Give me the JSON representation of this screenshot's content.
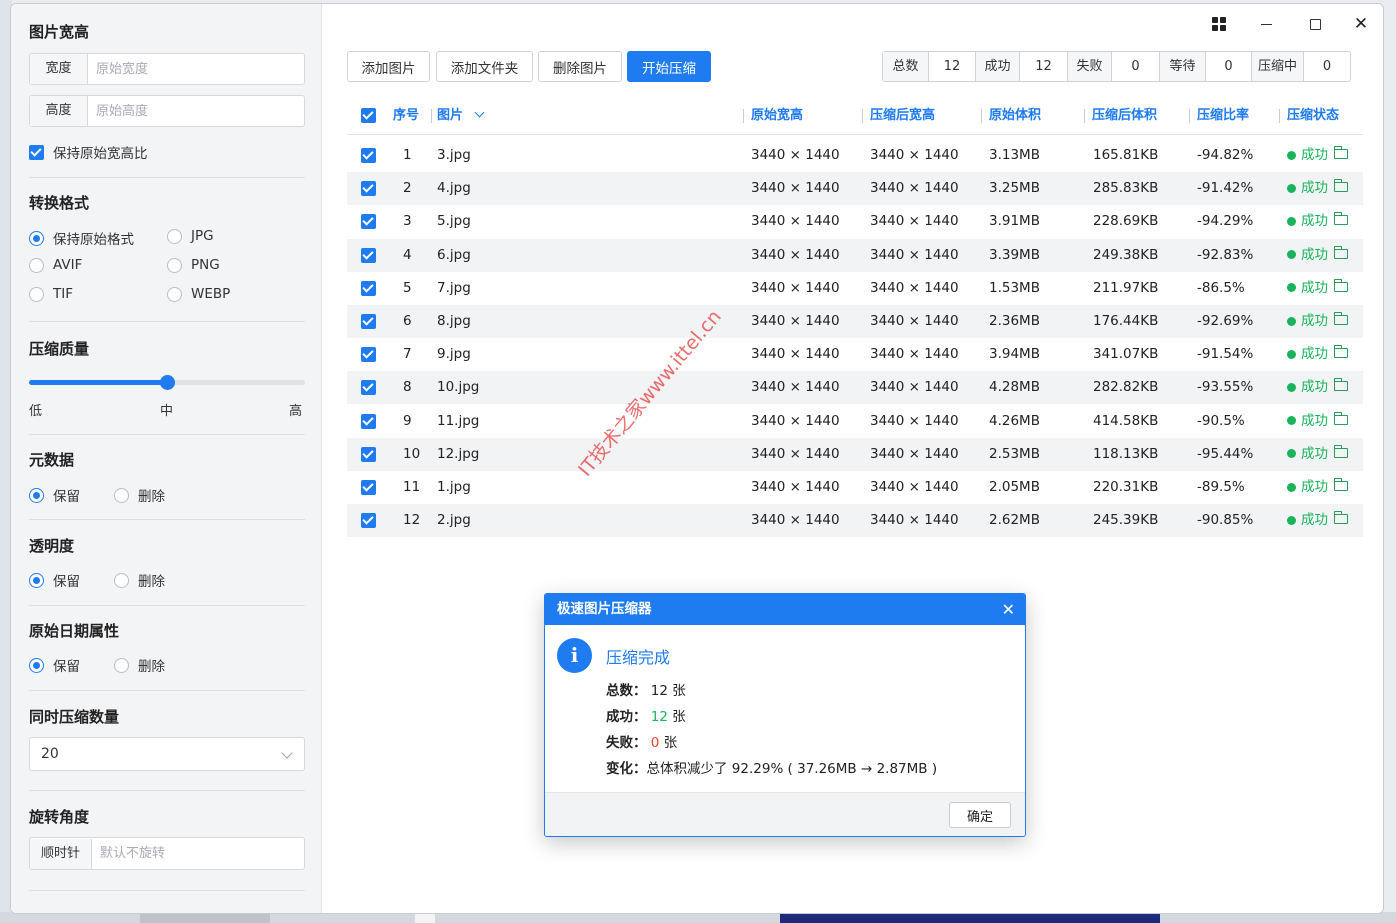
{
  "left_panel": {
    "size_section": {
      "title": "图片宽高",
      "width_label": "宽度",
      "width_placeholder": "原始宽度",
      "height_label": "高度",
      "height_placeholder": "原始高度",
      "keep_ratio_label": "保持原始宽高比",
      "keep_ratio_checked": true
    },
    "format_section": {
      "title": "转换格式",
      "options": [
        "保持原始格式",
        "JPG",
        "AVIF",
        "PNG",
        "TIF",
        "WEBP"
      ],
      "selected": "保持原始格式"
    },
    "quality_section": {
      "title": "压缩质量",
      "low": "低",
      "mid": "中",
      "high": "高",
      "value_fraction": 0.5
    },
    "metadata_section": {
      "title": "元数据",
      "keep": "保留",
      "delete": "删除",
      "selected": "保留"
    },
    "transparency_section": {
      "title": "透明度",
      "keep": "保留",
      "delete": "删除",
      "selected": "保留"
    },
    "date_section": {
      "title": "原始日期属性",
      "keep": "保留",
      "delete": "删除",
      "selected": "保留"
    },
    "concurrency_section": {
      "title": "同时压缩数量",
      "value": "20"
    },
    "rotation_section": {
      "title": "旋转角度",
      "label": "顺时针",
      "placeholder": "默认不旋转"
    }
  },
  "toolbar": {
    "add_image": "添加图片",
    "add_folder": "添加文件夹",
    "delete_image": "删除图片",
    "start": "开始压缩"
  },
  "stats": {
    "total_label": "总数",
    "total": "12",
    "success_label": "成功",
    "success": "12",
    "fail_label": "失败",
    "fail": "0",
    "waiting_label": "等待",
    "waiting": "0",
    "compressing_label": "压缩中",
    "compressing": "0"
  },
  "table": {
    "columns": [
      "序号",
      "图片",
      "原始宽高",
      "压缩后宽高",
      "原始体积",
      "压缩后体积",
      "压缩比率",
      "压缩状态"
    ],
    "rows": [
      {
        "idx": "1",
        "name": "3.jpg",
        "orig": "3440 × 1440",
        "new": "3440 × 1440",
        "orig_size": "3.13MB",
        "new_size": "165.81KB",
        "ratio": "-94.82%",
        "status": "成功"
      },
      {
        "idx": "2",
        "name": "4.jpg",
        "orig": "3440 × 1440",
        "new": "3440 × 1440",
        "orig_size": "3.25MB",
        "new_size": "285.83KB",
        "ratio": "-91.42%",
        "status": "成功"
      },
      {
        "idx": "3",
        "name": "5.jpg",
        "orig": "3440 × 1440",
        "new": "3440 × 1440",
        "orig_size": "3.91MB",
        "new_size": "228.69KB",
        "ratio": "-94.29%",
        "status": "成功"
      },
      {
        "idx": "4",
        "name": "6.jpg",
        "orig": "3440 × 1440",
        "new": "3440 × 1440",
        "orig_size": "3.39MB",
        "new_size": "249.38KB",
        "ratio": "-92.83%",
        "status": "成功"
      },
      {
        "idx": "5",
        "name": "7.jpg",
        "orig": "3440 × 1440",
        "new": "3440 × 1440",
        "orig_size": "1.53MB",
        "new_size": "211.97KB",
        "ratio": "-86.5%",
        "status": "成功"
      },
      {
        "idx": "6",
        "name": "8.jpg",
        "orig": "3440 × 1440",
        "new": "3440 × 1440",
        "orig_size": "2.36MB",
        "new_size": "176.44KB",
        "ratio": "-92.69%",
        "status": "成功"
      },
      {
        "idx": "7",
        "name": "9.jpg",
        "orig": "3440 × 1440",
        "new": "3440 × 1440",
        "orig_size": "3.94MB",
        "new_size": "341.07KB",
        "ratio": "-91.54%",
        "status": "成功"
      },
      {
        "idx": "8",
        "name": "10.jpg",
        "orig": "3440 × 1440",
        "new": "3440 × 1440",
        "orig_size": "4.28MB",
        "new_size": "282.82KB",
        "ratio": "-93.55%",
        "status": "成功"
      },
      {
        "idx": "9",
        "name": "11.jpg",
        "orig": "3440 × 1440",
        "new": "3440 × 1440",
        "orig_size": "4.26MB",
        "new_size": "414.58KB",
        "ratio": "-90.5%",
        "status": "成功"
      },
      {
        "idx": "10",
        "name": "12.jpg",
        "orig": "3440 × 1440",
        "new": "3440 × 1440",
        "orig_size": "2.53MB",
        "new_size": "118.13KB",
        "ratio": "-95.44%",
        "status": "成功"
      },
      {
        "idx": "11",
        "name": "1.jpg",
        "orig": "3440 × 1440",
        "new": "3440 × 1440",
        "orig_size": "2.05MB",
        "new_size": "220.31KB",
        "ratio": "-89.5%",
        "status": "成功"
      },
      {
        "idx": "12",
        "name": "2.jpg",
        "orig": "3440 × 1440",
        "new": "3440 × 1440",
        "orig_size": "2.62MB",
        "new_size": "245.39KB",
        "ratio": "-90.85%",
        "status": "成功"
      }
    ]
  },
  "watermark": "IT技术之家www.ittel.cn",
  "dialog": {
    "title": "极速图片压缩器",
    "heading": "压缩完成",
    "total_label": "总数：",
    "total_value": "12",
    "success_label": "成功：",
    "success_value": "12",
    "fail_label": "失败：",
    "fail_value": "0",
    "unit": "张",
    "change_label": "变化：",
    "change_text": "总体积减少了 92.29% ( 37.26MB → 2.87MB )",
    "ok_label": "确定"
  },
  "colors": {
    "accent": "#1e7bf0",
    "success": "#19b45a",
    "fail": "#e5452f"
  }
}
